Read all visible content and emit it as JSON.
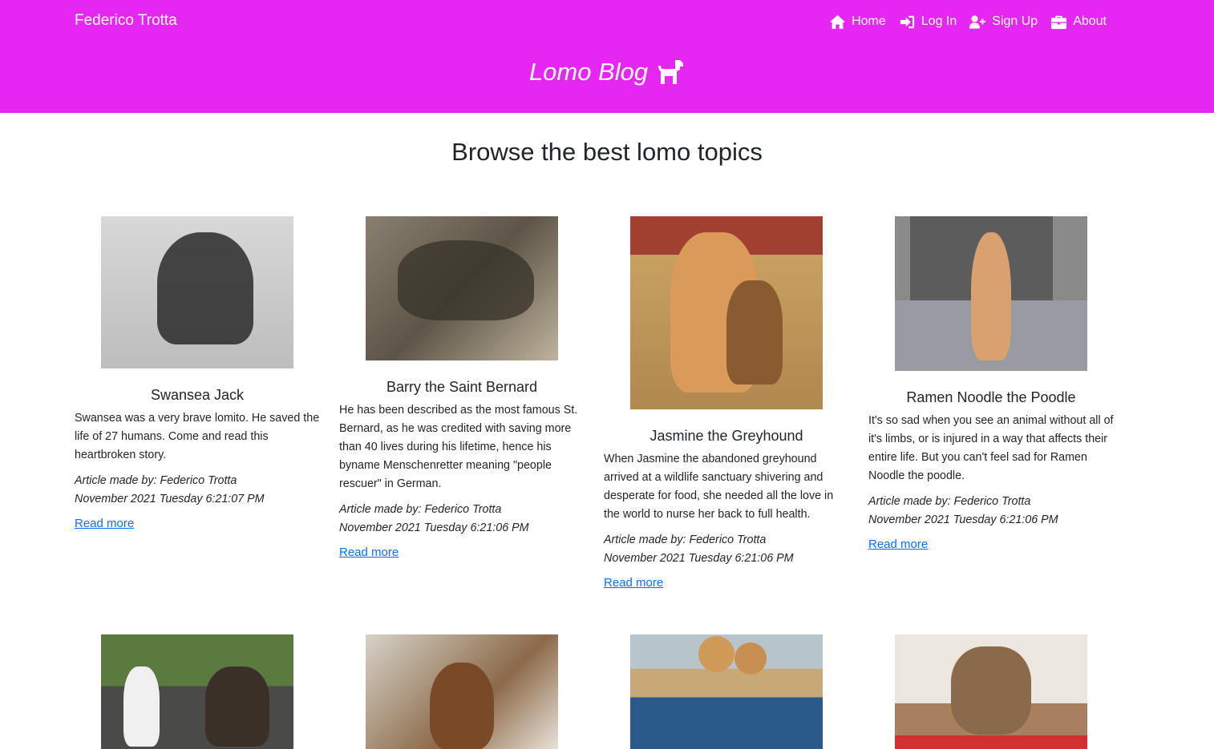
{
  "header": {
    "brand": "Federico Trotta",
    "nav": [
      {
        "label": "Home",
        "icon": "home-icon"
      },
      {
        "label": "Log In",
        "icon": "sign-in-icon"
      },
      {
        "label": "Sign Up",
        "icon": "user-plus-icon"
      },
      {
        "label": "About",
        "icon": "briefcase-icon"
      }
    ],
    "blog_title": "Lomo Blog",
    "blog_icon": "dog-icon",
    "background_color": "#e626f3"
  },
  "main": {
    "heading": "Browse the best lomo topics",
    "articles": [
      {
        "title": "Swansea Jack",
        "excerpt": "Swansea was a very brave lomito. He saved the life of 27 humans. Come and read this heartbroken story.",
        "byline": "Article made by: Federico Trotta",
        "date": "November 2021 Tuesday 6:21:07 PM",
        "link": "Read more"
      },
      {
        "title": "Barry the Saint Bernard",
        "excerpt": "He has been described as the most famous St. Bernard, as he was credited with saving more than 40 lives during his lifetime, hence his byname Menschenretter meaning \"people rescuer\" in German.",
        "byline": "Article made by: Federico Trotta",
        "date": "November 2021 Tuesday 6:21:06 PM",
        "link": "Read more"
      },
      {
        "title": "Jasmine the Greyhound",
        "excerpt": "When Jasmine the abandoned greyhound arrived at a wildlife sanctuary shivering and desperate for food, she needed all the love in the world to nurse her back to full health.",
        "byline": "Article made by: Federico Trotta",
        "date": "November 2021 Tuesday 6:21:06 PM",
        "link": "Read more"
      },
      {
        "title": "Ramen Noodle the Poodle",
        "excerpt": "It's so sad when you see an animal without all of it's limbs, or is injured in a way that affects their entire life. But you can't feel sad for Ramen Noodle the poodle.",
        "byline": "Article made by: Federico Trotta",
        "date": "November 2021 Tuesday 6:21:06 PM",
        "link": "Read more"
      }
    ],
    "link_color": "#0d6efd"
  }
}
